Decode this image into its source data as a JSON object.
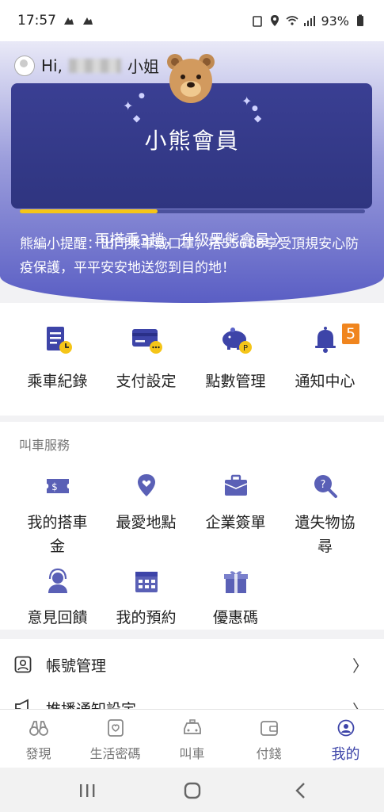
{
  "status_bar": {
    "time": "17:57",
    "battery": "93%"
  },
  "header": {
    "greeting_prefix": "Hi,",
    "greeting_suffix": "小姐",
    "membership_title": "小熊會員",
    "upgrade_text": "再搭乘3趟，升級黑熊會員 〉",
    "progress_fraction": 0.4,
    "tip": "熊編小提醒：出門乘車戴口罩，搭55688享受頂規安心防疫保護，平平安安地送您到目的地！"
  },
  "quick_actions": [
    {
      "label": "乘車紀錄",
      "icon": "ride-record-icon"
    },
    {
      "label": "支付設定",
      "icon": "payment-card-icon"
    },
    {
      "label": "點數管理",
      "icon": "piggy-bank-icon"
    },
    {
      "label": "通知中心",
      "icon": "bell-icon"
    }
  ],
  "notification_badge": "5",
  "services": {
    "title": "叫車服務",
    "items": [
      {
        "label": "我的搭車金",
        "icon": "ride-credit-ticket-icon"
      },
      {
        "label": "最愛地點",
        "icon": "favorite-place-icon"
      },
      {
        "label": "企業簽單",
        "icon": "corporate-bag-icon"
      },
      {
        "label": "遺失物協尋",
        "icon": "lost-item-search-icon"
      },
      {
        "label": "意見回饋",
        "icon": "feedback-headset-icon"
      },
      {
        "label": "我的預約",
        "icon": "calendar-icon"
      },
      {
        "label": "優惠碼",
        "icon": "gift-icon"
      }
    ]
  },
  "settings_list": [
    {
      "label": "帳號管理",
      "icon": "account-id-icon"
    },
    {
      "label": "推播通知設定",
      "icon": "megaphone-icon"
    }
  ],
  "tabs": [
    {
      "label": "發現",
      "icon": "binoculars-icon"
    },
    {
      "label": "生活密碼",
      "icon": "life-code-icon"
    },
    {
      "label": "叫車",
      "icon": "taxi-icon"
    },
    {
      "label": "付錢",
      "icon": "wallet-icon"
    },
    {
      "label": "我的",
      "icon": "profile-icon",
      "active": true
    }
  ],
  "colors": {
    "primary": "#3d44a8",
    "accent_yellow": "#f5c518",
    "badge_orange": "#f0851e"
  }
}
